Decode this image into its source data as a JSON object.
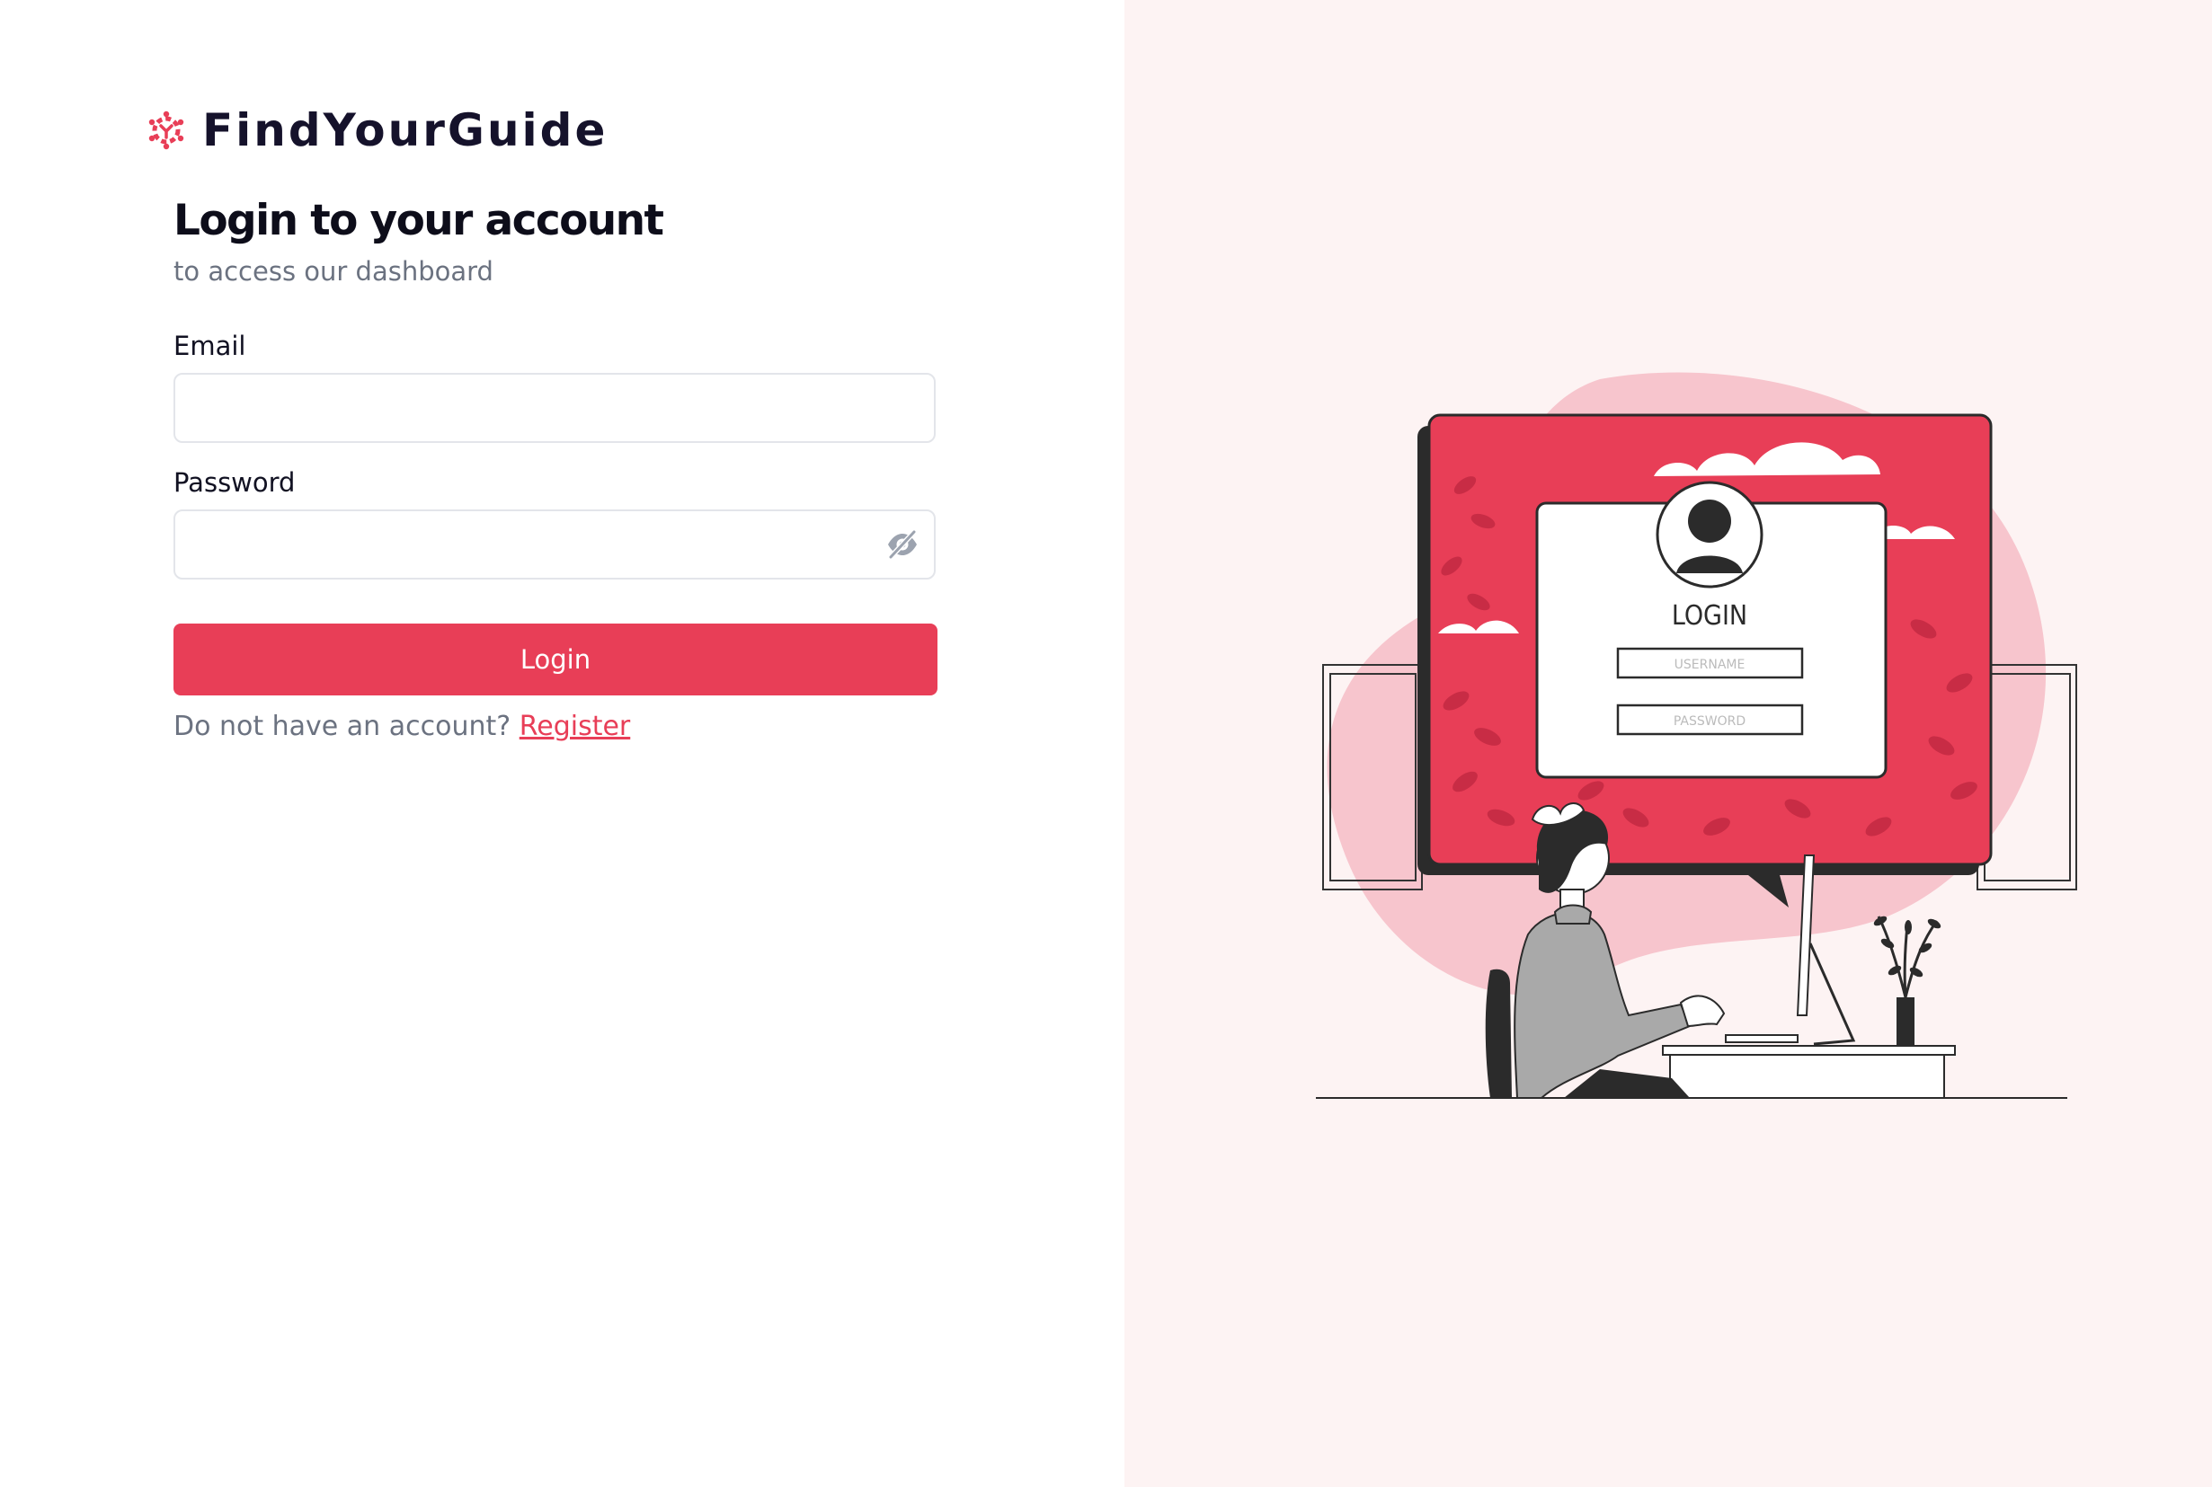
{
  "brand": {
    "name": "FindYourGuide",
    "logo_icon": "hexagon-dots-logo-icon"
  },
  "colors": {
    "accent": "#e83e57",
    "right_panel_bg": "#fdf3f3",
    "muted_text": "#6b7280"
  },
  "form": {
    "title": "Login to your account",
    "subtitle": "to access our dashboard",
    "email_label": "Email",
    "email_value": "",
    "password_label": "Password",
    "password_value": "",
    "password_toggle_icon": "eye-off-icon",
    "submit_label": "Login",
    "register_prompt": "Do not have an account?",
    "register_link": "Register"
  },
  "illustration": {
    "login_title": "LOGIN",
    "username_placeholder": "USERNAME",
    "password_placeholder": "PASSWORD"
  }
}
